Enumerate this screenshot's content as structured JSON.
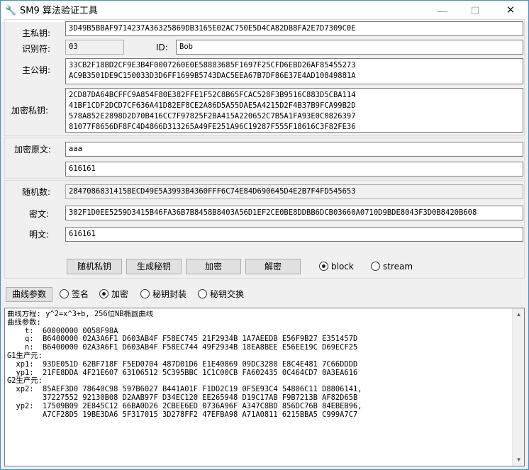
{
  "window": {
    "title": "SM9 算法验证工具",
    "controls": {
      "minimize": "—",
      "maximize": "☐",
      "close": "✕"
    }
  },
  "keys": {
    "master_private_label": "主私钥:",
    "master_private_value": "3D49B5BBAF9714237A36325869DB3165E02AC750E5D4CA82DB8FA2E7D7309C0E",
    "identifier_label": "识别符:",
    "identifier_value": "03",
    "id_label": "ID:",
    "id_value": "Bob",
    "master_public_label": "主公钥:",
    "master_public_value": "33CB2F18BD2CF9E3B4F0007260E0E58883685F1697F25CFD6EBD26AF85455273\nAC9B3501DE9C150033D3D6FF1699B5743DAC5EEA67B7DF86E37E4AD10849881A",
    "enc_private_label": "加密私钥:",
    "enc_private_value": "2CD87DA64BCFFC9A854F80E382FFE1F52C8B65FCAC528F3B9516C883D5CBA114\n41BF1CDF2DCD7CF636A41D82EF8CE2A86D5A55DAE5A4215D2F4B37B9FCA99B2D\n578A852E2898D2D70B416CC7F97825F2BA415A220652C7B5A1FA93E0C0826397\n81077F8656DF8FC4D4866D313265A49FE251A96C19287F555F18616C3F82FE36"
  },
  "plaintext": {
    "label": "加密原文:",
    "value": "aaa",
    "hex_value": "616161"
  },
  "crypto": {
    "random_label": "随机数:",
    "random_value": "2847086831415BECD49E5A3993B4360FFF6C74E84D690645D4E2B7F4FD545653",
    "cipher_label": "密文:",
    "cipher_value": "302F1D0EE5259D3415B46FA36B7B8458B8403A56D1EF2CE0BE8DDBB6DCB03660A0710D9BDE8043F3D0B8420B608",
    "decrypted_label": "明文:",
    "decrypted_value": "616161"
  },
  "actions": {
    "random_key": "随机私钥",
    "generate_key": "生成秘钥",
    "encrypt": "加密",
    "decrypt": "解密",
    "mode_block": "block",
    "mode_stream": "stream",
    "selected_mode": "block"
  },
  "params": {
    "button": "曲线参数",
    "opt_sign": "签名",
    "opt_encrypt": "加密",
    "opt_encap": "秘钥封装",
    "opt_exchange": "秘钥交换",
    "selected": "加密"
  },
  "curve_info": "曲线方程: y^2=x^3+b, 256位NB椭圆曲线\n曲线参数:\n    t:  60000000 0058F98A\n    q:  B6400000 02A3A6F1 D603AB4F F58EC745 21F2934B 1A7AEEDB E56F9B27 E351457D\n    n:  B6400000 02A3A6F1 D603AB4F F58EC744 49F2934B 18EA8BEE E56EE19C D69ECF25\nG1生产元:\n  xp1:  93DE051D 62BF718F F5ED0704 487D01D6 E1E40869 09DC3280 E8C4E481 7C66DDDD\n  yp1:  21FE8DDA 4F21E607 63106512 5C395BBC 1C1C00CB FA602435 0C464CD7 0A3EA616\nG2生产元:\n  xp2:  85AEF3D0 78640C98 597B6027 B441A01F F1DD2C19 0F5E93C4 54806C11 D8806141,\n        37227552 92130B08 D2AAB97F D34EC120 EE265948 D19C17AB F9B7213B AF82D65B\n  yp2:  17509B09 2E845C12 66BA0D26 2CBEE6ED 0736A96F A347C8BD 856DC76B 84EBEB96,\n        A7CF28D5 19BE3DA6 5F317015 3D278FF2 47EFBA98 A71A0811 6215BBA5 C999A7C7"
}
